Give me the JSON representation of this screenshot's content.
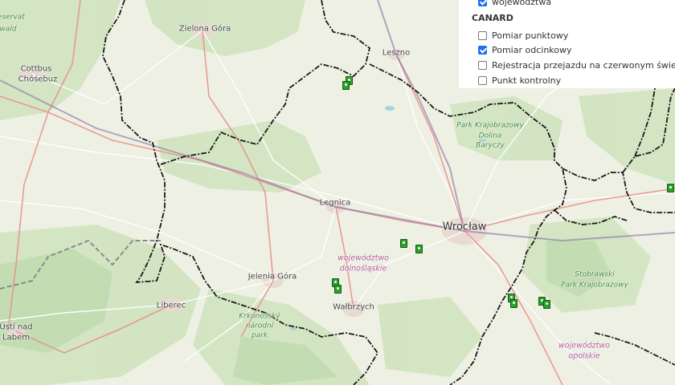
{
  "map": {
    "labels": {
      "zielona_gora": "Zielona Góra",
      "leszno": "Leszno",
      "cottbus": "Cottbus",
      "chosebuz": "Chóśebuz",
      "legnica": "Legnica",
      "wroclaw": "Wrocław",
      "jelenia_gora": "Jelenia Góra",
      "walbrzych": "Wałbrzych",
      "liberec": "Liberec",
      "usti_line1": "Ústí nad",
      "usti_line2": "Labem",
      "reservat_line1": "reservat",
      "reservat_line2": "wald"
    },
    "parks": {
      "dolina_baryczy": [
        "Park Krajobrazowy",
        "Dolina",
        "Baryczy"
      ],
      "stobrawski": [
        "Stobrawski",
        "Park Krajobrazowy"
      ],
      "krkonossky": [
        "Krkonošský",
        "národní",
        "park"
      ]
    },
    "regions": {
      "dolnoslaskie": [
        "województwo",
        "dolnośląskie"
      ],
      "opolskie": [
        "województwo",
        "opolskie"
      ]
    }
  },
  "layers_panel": {
    "top_item": {
      "label": "województwa",
      "checked": true
    },
    "section_title": "CANARD",
    "items": [
      {
        "label": "Pomiar punktowy",
        "checked": false
      },
      {
        "label": "Pomiar odcinkowy",
        "checked": true
      },
      {
        "label": "Rejestracja przejazdu na czerwonym świetle",
        "checked": false
      },
      {
        "label": "Punkt kontrolny",
        "checked": false
      }
    ]
  },
  "colors": {
    "camera_marker": "#2fa02f",
    "border_line": "#111111",
    "region_label": "#b35d9e",
    "park_label": "#3f8a3f",
    "checkbox_checked": "#1a73e8"
  }
}
